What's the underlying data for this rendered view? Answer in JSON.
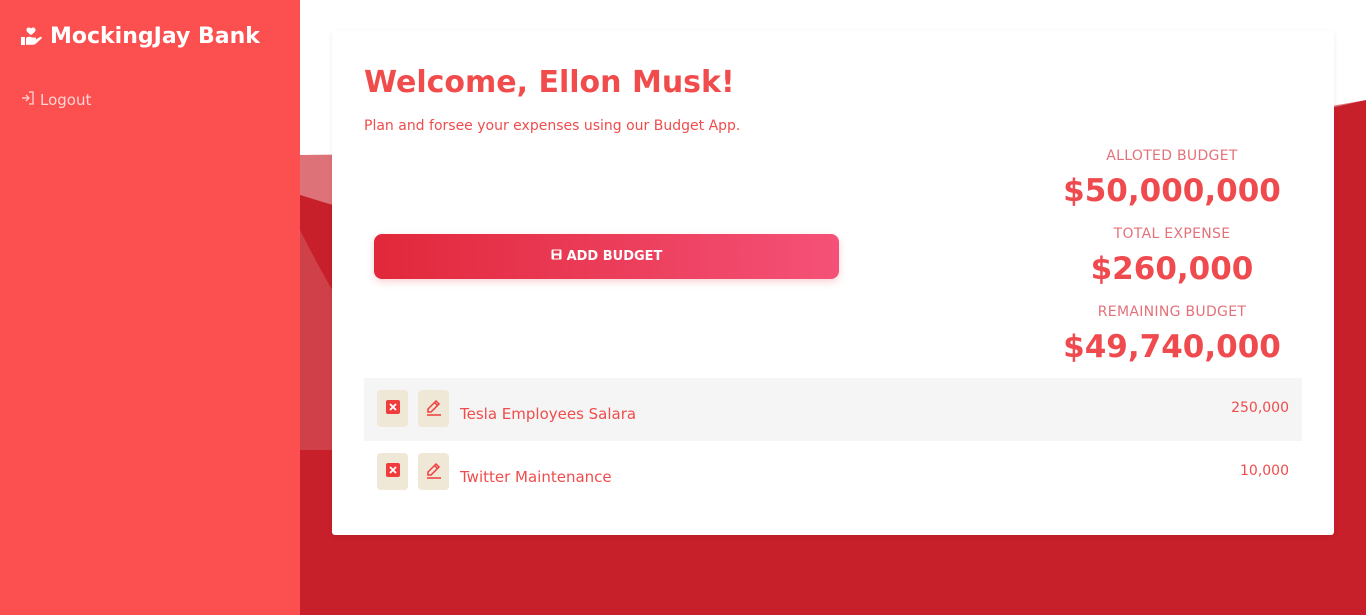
{
  "app": {
    "brand_name": "MockingJay Bank",
    "brand_icon": "hand-heart-icon"
  },
  "sidebar": {
    "logout_label": "Logout",
    "logout_icon": "sign-out-icon"
  },
  "header": {
    "welcome": "Welcome, Ellon Musk!",
    "subtitle": "Plan and forsee your expenses using our Budget App."
  },
  "actions": {
    "add_budget_label": "ADD BUDGET",
    "add_budget_icon": "save-icon"
  },
  "stats": {
    "alloted_label": "ALLOTED BUDGET",
    "alloted_value": "$50,000,000",
    "expense_label": "TOTAL EXPENSE",
    "expense_value": "$260,000",
    "remaining_label": "REMAINING BUDGET",
    "remaining_value": "$49,740,000"
  },
  "expenses": [
    {
      "name": "Tesla Employees Salara",
      "amount": "250,000"
    },
    {
      "name": "Twitter Maintenance",
      "amount": "10,000"
    }
  ],
  "colors": {
    "sidebar": "#fc4f4f",
    "accent": "#f04c4c",
    "background": "#c8202a",
    "button_gradient_start": "#e1283a",
    "button_gradient_end": "#f55178",
    "icon_button_bg": "#efe8d6"
  }
}
